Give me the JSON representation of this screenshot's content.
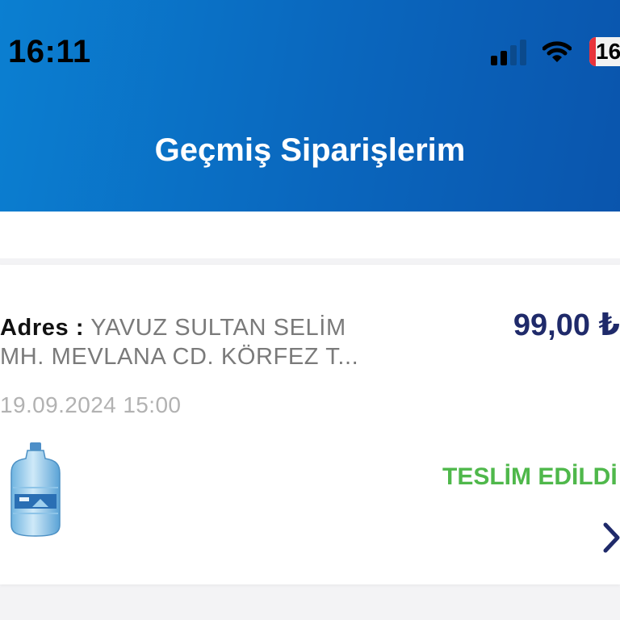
{
  "status_bar": {
    "time": "16:11",
    "battery_level": "16",
    "icons": [
      "signal-icon",
      "wifi-icon",
      "battery-icon"
    ]
  },
  "header": {
    "title": "Geçmiş Siparişlerim"
  },
  "orders": [
    {
      "address_label": "Adres :",
      "address": "YAVUZ SULTAN SELİM MH.  MEVLANA CD. KÖRFEZ T...",
      "date": "19.09.2024 15:00",
      "price": "99,00 ₺",
      "status": "TESLİM EDİLDİ",
      "product_icon": "water-jug-icon"
    }
  ],
  "colors": {
    "header_gradient_start": "#0b7fd1",
    "header_gradient_end": "#0a55ad",
    "price": "#1f2a6a",
    "status_delivered": "#4fb84b",
    "address_text": "#7a7a7a",
    "date_text": "#b2b2b2"
  }
}
